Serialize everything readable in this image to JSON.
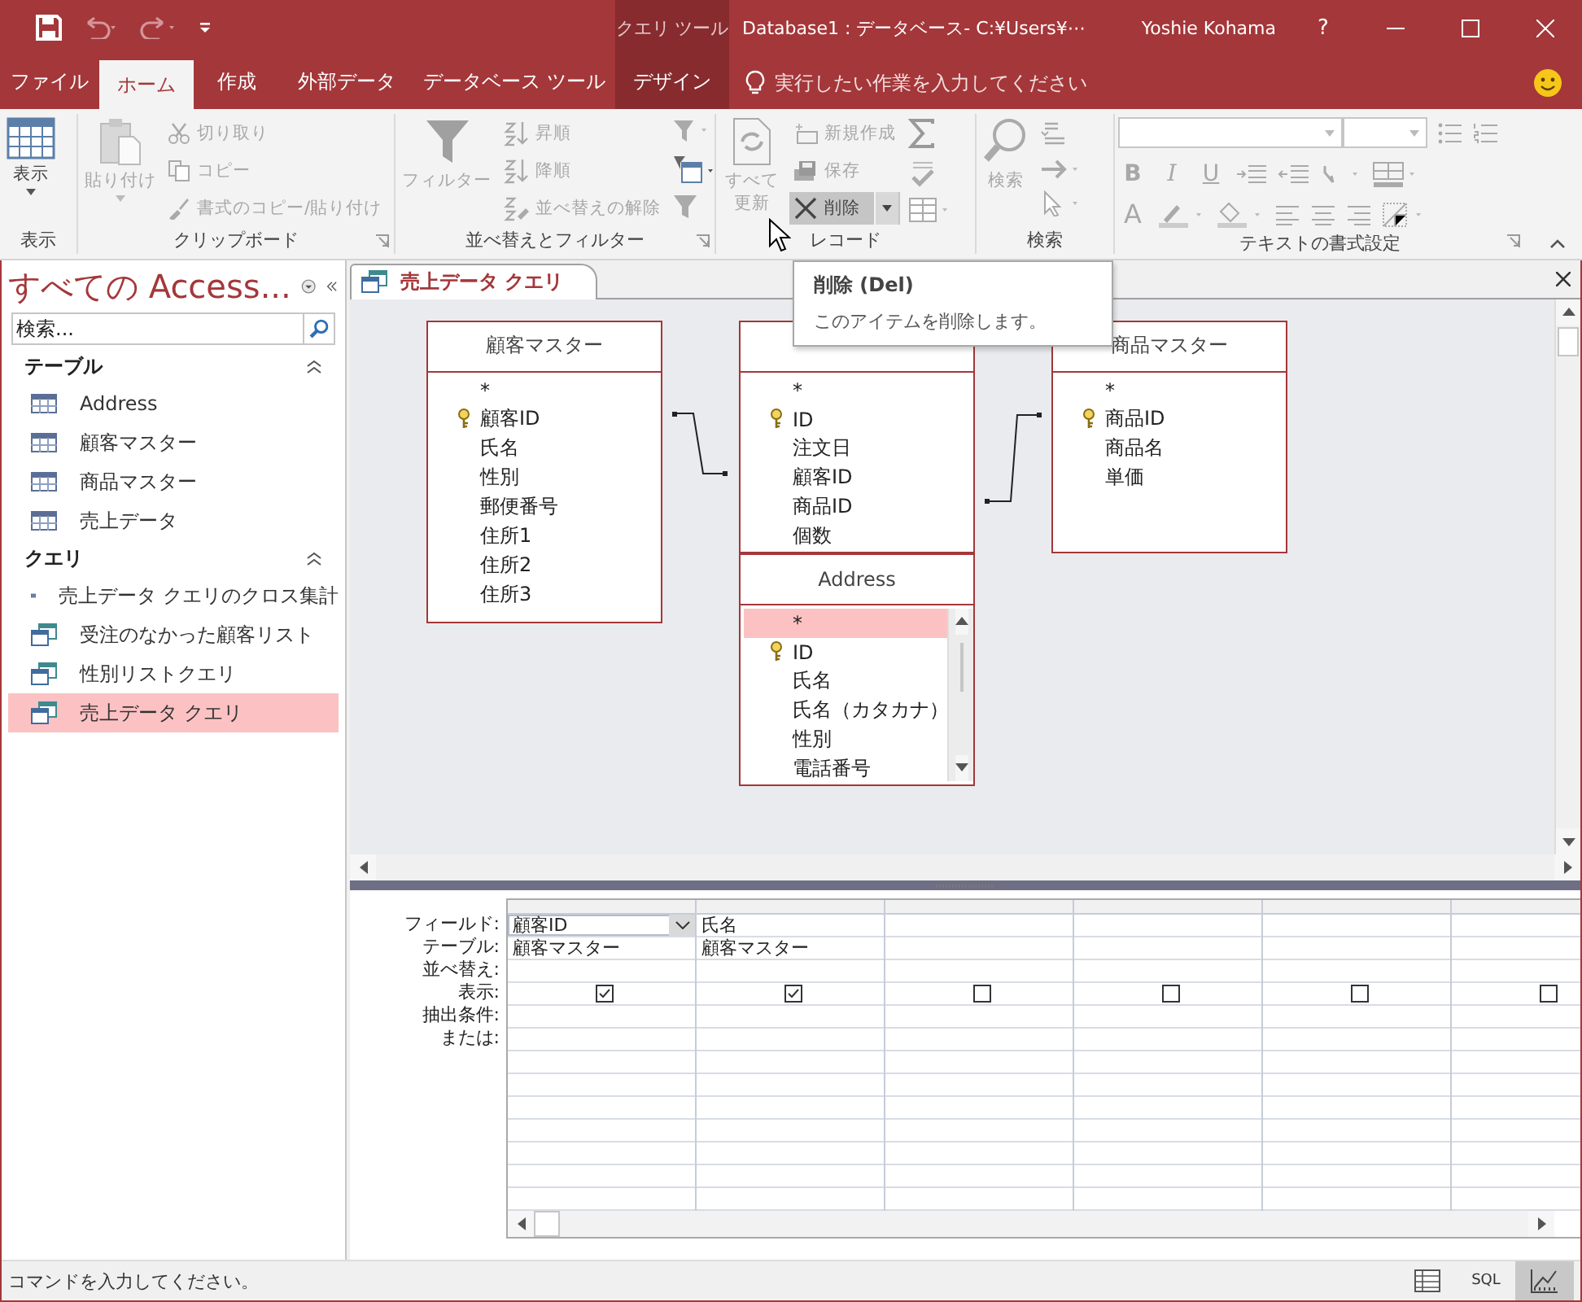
{
  "title_bar": {
    "contextual_label": "クエリ ツール",
    "title": "Database1 : データベース- C:¥Users¥⋯",
    "user": "Yoshie Kohama",
    "help": "?"
  },
  "ribbon_tabs": [
    {
      "label": "ファイル",
      "selected": false,
      "kind": "normal"
    },
    {
      "label": "ホーム",
      "selected": true,
      "kind": "normal"
    },
    {
      "label": "作成",
      "selected": false,
      "kind": "normal"
    },
    {
      "label": "外部データ",
      "selected": false,
      "kind": "normal"
    },
    {
      "label": "データベース ツール",
      "selected": false,
      "kind": "normal"
    },
    {
      "label": "デザイン",
      "selected": false,
      "kind": "contextual"
    }
  ],
  "tell_me": {
    "placeholder": "実行したい作業を入力してください"
  },
  "ribbon": {
    "groups": [
      {
        "label": "表示",
        "commands": [
          {
            "label": "表示",
            "disabled": false,
            "hovered": false
          }
        ]
      },
      {
        "label": "クリップボード",
        "commands": [
          {
            "label": "貼り付け",
            "disabled": true,
            "hovered": false
          },
          {
            "label": "切り取り",
            "disabled": true,
            "hovered": false
          },
          {
            "label": "コピー",
            "disabled": true,
            "hovered": false
          },
          {
            "label": "書式のコピー/貼り付け",
            "disabled": true,
            "hovered": false
          }
        ]
      },
      {
        "label": "並べ替えとフィルター",
        "commands": [
          {
            "label": "フィルター",
            "disabled": true,
            "hovered": false
          },
          {
            "label": "昇順",
            "disabled": true,
            "hovered": false
          },
          {
            "label": "降順",
            "disabled": true,
            "hovered": false
          },
          {
            "label": "並べ替えの解除",
            "disabled": true,
            "hovered": false
          }
        ]
      },
      {
        "label": "レコード",
        "commands": [
          {
            "label": "すべて更新",
            "disabled": true,
            "hovered": false
          },
          {
            "label": "新規作成",
            "disabled": true,
            "hovered": false
          },
          {
            "label": "保存",
            "disabled": true,
            "hovered": false
          },
          {
            "label": "削除",
            "disabled": false,
            "hovered": true
          }
        ]
      },
      {
        "label": "検索",
        "commands": [
          {
            "label": "検索",
            "disabled": true,
            "hovered": false
          }
        ]
      },
      {
        "label": "テキストの書式設定",
        "format_keys": [
          "B",
          "I",
          "U",
          "A"
        ]
      }
    ]
  },
  "navigation": {
    "title": "すべての Access...",
    "search": {
      "placeholder": "検索..."
    },
    "groups": [
      {
        "label": "テーブル",
        "expanded": true,
        "items": [
          {
            "label": "Address",
            "kind": "table",
            "selected": false
          },
          {
            "label": "顧客マスター",
            "kind": "table",
            "selected": false
          },
          {
            "label": "商品マスター",
            "kind": "table",
            "selected": false
          },
          {
            "label": "売上データ",
            "kind": "table",
            "selected": false
          }
        ]
      },
      {
        "label": "クエリ",
        "expanded": true,
        "items": [
          {
            "label": "売上データ クエリのクロス集計",
            "kind": "crosstab",
            "selected": false
          },
          {
            "label": "受注のなかった顧客リスト",
            "kind": "query",
            "selected": false
          },
          {
            "label": "性別リストクエリ",
            "kind": "query",
            "selected": false
          },
          {
            "label": "売上データ クエリ",
            "kind": "query",
            "selected": true
          }
        ]
      }
    ]
  },
  "document_tab": {
    "label": "売上データ クエリ"
  },
  "diagram": {
    "tables": [
      {
        "title": "顧客マスター",
        "has_scrollbar": false,
        "fields": [
          {
            "name": "*",
            "key": false
          },
          {
            "name": "顧客ID",
            "key": true
          },
          {
            "name": "氏名",
            "key": false
          },
          {
            "name": "性別",
            "key": false
          },
          {
            "name": "郵便番号",
            "key": false
          },
          {
            "name": "住所1",
            "key": false
          },
          {
            "name": "住所2",
            "key": false
          },
          {
            "name": "住所3",
            "key": false
          }
        ]
      },
      {
        "has_scrollbar": false,
        "fields": [
          {
            "name": "*",
            "key": false
          },
          {
            "name": "ID",
            "key": true
          },
          {
            "name": "注文日",
            "key": false
          },
          {
            "name": "顧客ID",
            "key": false
          },
          {
            "name": "商品ID",
            "key": false
          },
          {
            "name": "個数",
            "key": false
          }
        ]
      },
      {
        "title": "商品マスター",
        "has_scrollbar": false,
        "fields": [
          {
            "name": "*",
            "key": false
          },
          {
            "name": "商品ID",
            "key": true
          },
          {
            "name": "商品名",
            "key": false
          },
          {
            "name": "単価",
            "key": false
          }
        ]
      },
      {
        "title": "Address",
        "has_scrollbar": true,
        "fields": [
          {
            "name": "*",
            "key": false,
            "selected": true
          },
          {
            "name": "ID",
            "key": true,
            "selected": false
          },
          {
            "name": "氏名",
            "key": false,
            "selected": false
          },
          {
            "name": "氏名（カタカナ）",
            "key": false,
            "selected": false
          },
          {
            "name": "性別",
            "key": false,
            "selected": false
          },
          {
            "name": "電話番号",
            "key": false,
            "selected": false
          }
        ]
      }
    ]
  },
  "tooltip": {
    "title": "削除 (Del)",
    "text": "このアイテムを削除します。"
  },
  "grid": {
    "row_labels": [
      "フィールド:",
      "テーブル:",
      "並べ替え:",
      "表示:",
      "抽出条件:",
      "または:"
    ],
    "columns": [
      {
        "field": "顧客ID",
        "table": "顧客マスター",
        "show": true,
        "active": true
      },
      {
        "field": "氏名",
        "table": "顧客マスター",
        "show": true,
        "active": false
      },
      {
        "show": false,
        "active": false
      },
      {
        "show": false,
        "active": false
      },
      {
        "show": false,
        "active": false
      },
      {
        "show": false,
        "active": false
      }
    ]
  },
  "status_bar": {
    "text": "コマンドを入力してください。",
    "views": [
      {
        "kind": "datasheet",
        "selected": false
      },
      {
        "kind": "sql",
        "label": "SQL",
        "selected": false
      },
      {
        "kind": "design",
        "selected": true
      }
    ]
  }
}
